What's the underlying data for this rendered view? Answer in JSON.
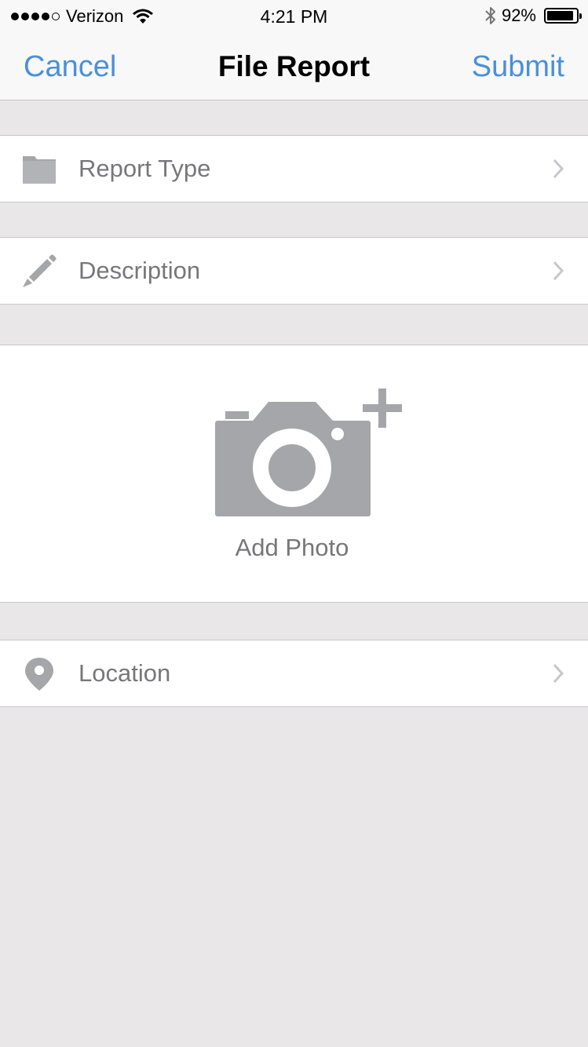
{
  "status_bar": {
    "signal_dots_filled": 4,
    "signal_dots_total": 5,
    "carrier": "Verizon",
    "time": "4:21 PM",
    "battery_percent": "92%",
    "battery_level": 0.92,
    "icons": [
      "wifi-icon",
      "bluetooth-icon",
      "battery-icon"
    ]
  },
  "nav": {
    "cancel_label": "Cancel",
    "title": "File Report",
    "submit_label": "Submit"
  },
  "rows": {
    "report_type": {
      "label": "Report Type",
      "icon": "folder-icon"
    },
    "description": {
      "label": "Description",
      "icon": "pencil-icon"
    },
    "location": {
      "label": "Location",
      "icon": "location-pin-icon"
    }
  },
  "photo": {
    "label": "Add Photo",
    "icon": "add-camera-icon"
  },
  "colors": {
    "accent": "#4a90d9",
    "background": "#e9e7e8",
    "icon_gray": "#a5a6a9",
    "label_gray": "#77777a",
    "separator": "#c8c7cc",
    "chevron": "#c7c7cc"
  }
}
